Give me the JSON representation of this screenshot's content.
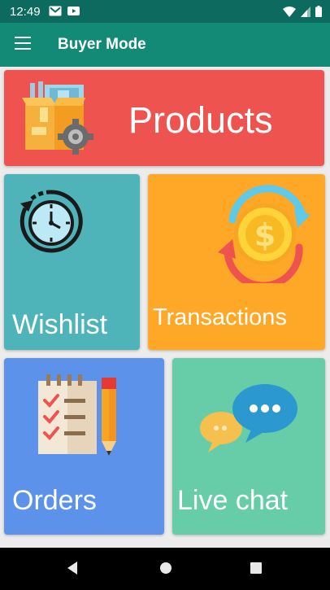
{
  "status_bar": {
    "time": "12:49",
    "icons": [
      "gmail-icon",
      "youtube-icon",
      "wifi-icon",
      "signal-icon",
      "battery-icon"
    ]
  },
  "app_bar": {
    "menu_icon": "hamburger-menu-icon",
    "title": "Buyer Mode",
    "color": "#138a76"
  },
  "tiles": [
    {
      "id": "products",
      "label": "Products",
      "color": "#ef5350",
      "icon": "box-gear-icon"
    },
    {
      "id": "wishlist",
      "label": "Wishlist",
      "color": "#4fb4ba",
      "icon": "clock-history-icon"
    },
    {
      "id": "transactions",
      "label": "Transactions",
      "color": "#ffa726",
      "icon": "dollar-exchange-icon"
    },
    {
      "id": "orders",
      "label": "Orders",
      "color": "#5c92ea",
      "icon": "checklist-pencil-icon"
    },
    {
      "id": "livechat",
      "label": "Live chat",
      "color": "#66cda8",
      "icon": "chat-bubbles-icon"
    }
  ],
  "nav_bar": {
    "buttons": [
      "back-icon",
      "home-icon",
      "recents-icon"
    ]
  }
}
